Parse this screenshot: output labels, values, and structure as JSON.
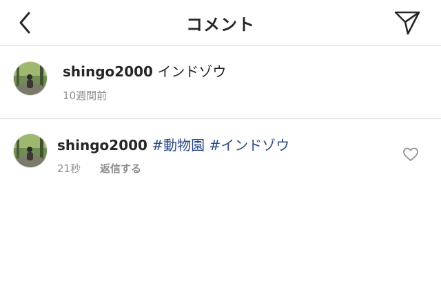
{
  "header": {
    "title": "コメント",
    "back_icon": "chevron-left-icon",
    "send_icon": "paper-plane-icon"
  },
  "caption": {
    "username": "shingo2000",
    "text": " インドゾウ",
    "time": "10週間前"
  },
  "comment": {
    "username": "shingo2000",
    "hashtags": [
      "#動物園",
      "#インドゾウ"
    ],
    "time": "21秒",
    "reply_label": "返信する",
    "like_icon": "heart-outline-icon"
  },
  "colors": {
    "text": "#262626",
    "muted": "#8e8e8e",
    "hashtag": "#2b4a84",
    "divider": "#dbdbdb"
  }
}
